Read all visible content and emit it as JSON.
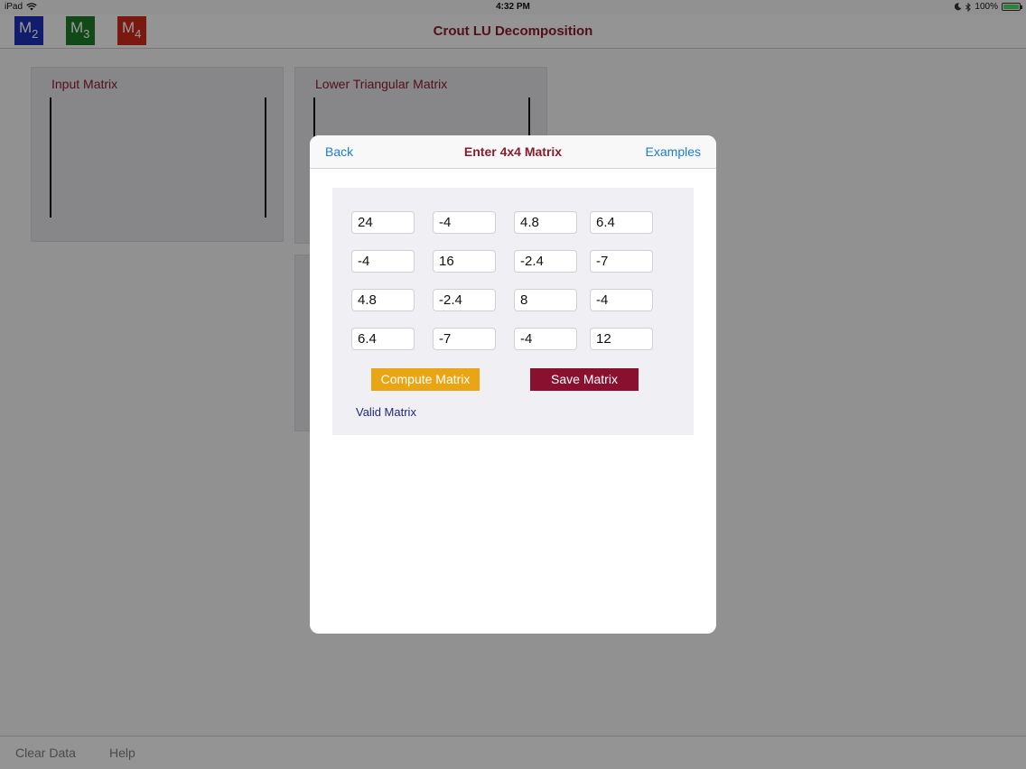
{
  "status": {
    "device": "iPad",
    "time": "4:32 PM",
    "battery": "100%"
  },
  "nav": {
    "title": "Crout LU Decomposition",
    "matrix_buttons": [
      {
        "letter": "M",
        "sub": "2",
        "color": "#1f2fb5"
      },
      {
        "letter": "M",
        "sub": "3",
        "color": "#1f7a2a"
      },
      {
        "letter": "M",
        "sub": "4",
        "color": "#cc2a1a"
      }
    ]
  },
  "panels": {
    "input_title": "Input Matrix",
    "lower_title": "Lower Triangular Matrix"
  },
  "bottom": {
    "clear": "Clear Data",
    "help": "Help"
  },
  "modal": {
    "back": "Back",
    "title": "Enter 4x4 Matrix",
    "examples": "Examples",
    "matrix": [
      [
        "24",
        "-4",
        "4.8",
        "6.4"
      ],
      [
        "-4",
        "16",
        "-2.4",
        "-7"
      ],
      [
        "4.8",
        "-2.4",
        "8",
        "-4"
      ],
      [
        "6.4",
        "-7",
        "-4",
        "12"
      ]
    ],
    "compute_label": "Compute Matrix",
    "save_label": "Save Matrix",
    "status_message": "Valid Matrix"
  },
  "colors": {
    "accent_title": "#8a1c2d",
    "link_blue": "#1a7ed0",
    "compute": "#e9a514",
    "save": "#8a1030"
  }
}
